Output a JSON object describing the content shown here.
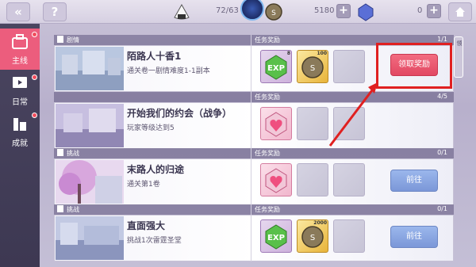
{
  "topbar": {
    "back_icon": "double-chevron-left-icon",
    "help_icon": "question-mark-icon",
    "stamina": "72/63",
    "coins": "5180",
    "crystals": "0",
    "home_icon": "home-icon",
    "plus": "+"
  },
  "sidebar": {
    "tabs": [
      {
        "label": "主线",
        "icon": "briefcase-icon"
      },
      {
        "label": "日常",
        "icon": "screen-icon"
      },
      {
        "label": "成就",
        "icon": "trophy-icon"
      }
    ]
  },
  "right_tab": {
    "label": "领"
  },
  "colors": {
    "accent": "#ec5d7d",
    "claim": "#e24862",
    "go": "#7b97d8",
    "highlight": "#e02020"
  },
  "reward_header": "任务奖励",
  "quests": [
    {
      "category": "剧情",
      "title": "陌路人十香1",
      "desc": "通关卷一剧情难度1-1副本",
      "progress": "1/1",
      "rewards": [
        {
          "type": "exp",
          "qty": "8"
        },
        {
          "type": "coin",
          "qty": "100"
        }
      ],
      "button": "领取奖励"
    },
    {
      "category": "",
      "title": "开始我们的约会（战争）",
      "desc": "玩家等级达到5",
      "progress": "4/5",
      "rewards": [
        {
          "type": "heart-crystal",
          "qty": ""
        }
      ],
      "button": ""
    },
    {
      "category": "挑战",
      "title": "末路人的归途",
      "desc": "通关第1卷",
      "progress": "0/1",
      "rewards": [
        {
          "type": "heart-crystal",
          "qty": ""
        }
      ],
      "button": "前往"
    },
    {
      "category": "挑战",
      "title": "直面强大",
      "desc": "挑战1次雷霆圣堂",
      "progress": "0/1",
      "rewards": [
        {
          "type": "exp",
          "qty": ""
        },
        {
          "type": "coin",
          "qty": "2000"
        }
      ],
      "button": "前往"
    }
  ]
}
